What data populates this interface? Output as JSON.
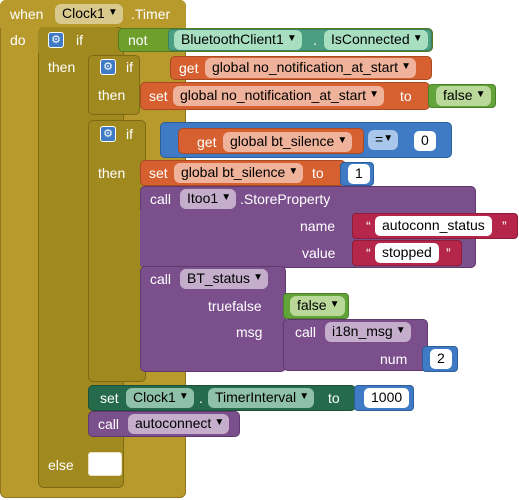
{
  "event": {
    "when_label": "when",
    "component": "Clock1",
    "event_name": ".Timer",
    "do_label": "do"
  },
  "outer_if": {
    "if_label": "if",
    "not_label": "not",
    "component": "BluetoothClient1",
    "dot": ".",
    "property": "IsConnected",
    "then_label": "then",
    "else_label": "else"
  },
  "inner_if1": {
    "if_label": "if",
    "get_label": "get",
    "get_var": "global no_notification_at_start",
    "then_label": "then",
    "set_label": "set",
    "set_var": "global no_notification_at_start",
    "to_label": "to",
    "set_value": "false"
  },
  "inner_if2": {
    "if_label": "if",
    "get_label": "get",
    "get_var": "global bt_silence",
    "op": "=",
    "compare_value": "0",
    "then_label": "then",
    "set_label": "set",
    "set_var": "global bt_silence",
    "to_label": "to",
    "set_value": "1",
    "call_label": "call",
    "store_component": "Itoo1",
    "store_method": ".StoreProperty",
    "name_label": "name",
    "name_value": "autoconn_status",
    "value_label": "value",
    "value_value": "stopped",
    "bt_call_label": "call",
    "bt_proc": "BT_status",
    "truefalse_label": "truefalse",
    "truefalse_value": "false",
    "msg_label": "msg",
    "i18n_call_label": "call",
    "i18n_proc": "i18n_msg",
    "num_label": "num",
    "num_value": "2"
  },
  "timer_set": {
    "set_label": "set",
    "component": "Clock1",
    "dot": ".",
    "property": "TimerInterval",
    "to_label": "to",
    "value": "1000"
  },
  "autoconnect_call": {
    "call_label": "call",
    "proc": "autoconnect"
  },
  "quote_char": "“",
  "quote_close_char": "”",
  "colors": {
    "event": "#B7992C",
    "control": "#A0891E",
    "variables": "#D6602F",
    "logic": "#6E9E2B",
    "math": "#3E7BC4",
    "procedures": "#7B4F8C",
    "text": "#B5264A",
    "component_setter": "#256B4B"
  }
}
